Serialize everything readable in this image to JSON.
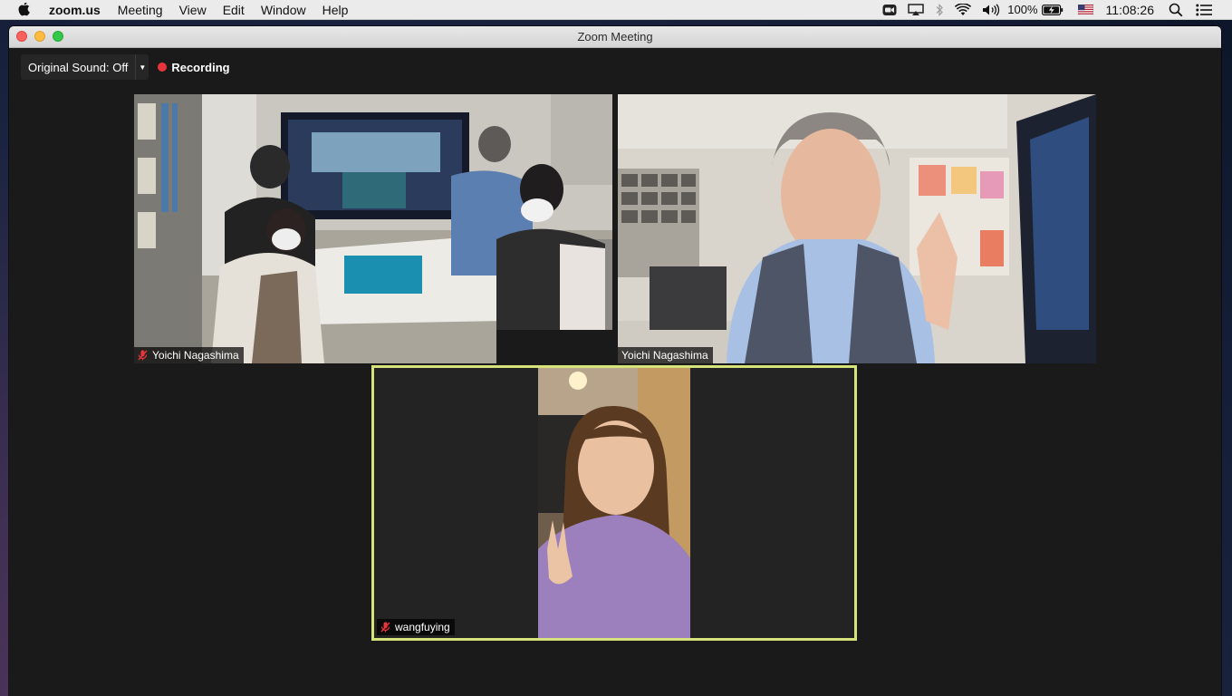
{
  "menubar": {
    "app_name": "zoom.us",
    "menus": [
      "Meeting",
      "View",
      "Edit",
      "Window",
      "Help"
    ],
    "battery": "100%",
    "clock": "11:08:26"
  },
  "window": {
    "title": "Zoom Meeting"
  },
  "toolbar": {
    "original_sound_label": "Original Sound: Off",
    "recording_label": "Recording"
  },
  "participants": [
    {
      "name": "Yoichi Nagashima",
      "muted": true,
      "active_speaker": false
    },
    {
      "name": "Yoichi Nagashima",
      "muted": true,
      "active_speaker": false
    },
    {
      "name": "wangfuying",
      "muted": true,
      "active_speaker": true
    }
  ],
  "colors": {
    "active_speaker_border": "#d6e27a",
    "recording_dot": "#e8353c",
    "muted_mic": "#e8353c"
  },
  "icons": [
    "apple-icon",
    "zoom-video-icon",
    "airplay-icon",
    "bluetooth-icon",
    "wifi-icon",
    "volume-icon",
    "battery-icon",
    "flag-icon",
    "spotlight-icon",
    "control-center-icon",
    "muted-mic-icon",
    "dropdown-caret-icon"
  ]
}
